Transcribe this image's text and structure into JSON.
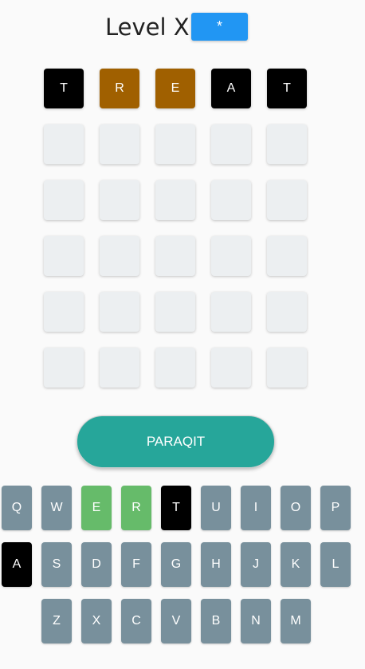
{
  "header": {
    "title": "Level X",
    "hint_button_label": "*"
  },
  "board": {
    "rows": [
      [
        {
          "letter": "T",
          "state": "absent"
        },
        {
          "letter": "R",
          "state": "present"
        },
        {
          "letter": "E",
          "state": "present"
        },
        {
          "letter": "A",
          "state": "absent"
        },
        {
          "letter": "T",
          "state": "absent"
        }
      ],
      [
        {
          "letter": "",
          "state": "empty"
        },
        {
          "letter": "",
          "state": "empty"
        },
        {
          "letter": "",
          "state": "empty"
        },
        {
          "letter": "",
          "state": "empty"
        },
        {
          "letter": "",
          "state": "empty"
        }
      ],
      [
        {
          "letter": "",
          "state": "empty"
        },
        {
          "letter": "",
          "state": "empty"
        },
        {
          "letter": "",
          "state": "empty"
        },
        {
          "letter": "",
          "state": "empty"
        },
        {
          "letter": "",
          "state": "empty"
        }
      ],
      [
        {
          "letter": "",
          "state": "empty"
        },
        {
          "letter": "",
          "state": "empty"
        },
        {
          "letter": "",
          "state": "empty"
        },
        {
          "letter": "",
          "state": "empty"
        },
        {
          "letter": "",
          "state": "empty"
        }
      ],
      [
        {
          "letter": "",
          "state": "empty"
        },
        {
          "letter": "",
          "state": "empty"
        },
        {
          "letter": "",
          "state": "empty"
        },
        {
          "letter": "",
          "state": "empty"
        },
        {
          "letter": "",
          "state": "empty"
        }
      ],
      [
        {
          "letter": "",
          "state": "empty"
        },
        {
          "letter": "",
          "state": "empty"
        },
        {
          "letter": "",
          "state": "empty"
        },
        {
          "letter": "",
          "state": "empty"
        },
        {
          "letter": "",
          "state": "empty"
        }
      ]
    ]
  },
  "submit_label": "PARAQIT",
  "keyboard": {
    "rows": [
      [
        {
          "key": "Q",
          "state": "unused"
        },
        {
          "key": "W",
          "state": "unused"
        },
        {
          "key": "E",
          "state": "correct"
        },
        {
          "key": "R",
          "state": "correct"
        },
        {
          "key": "T",
          "state": "absent"
        },
        {
          "key": "U",
          "state": "unused"
        },
        {
          "key": "I",
          "state": "unused"
        },
        {
          "key": "O",
          "state": "unused"
        },
        {
          "key": "P",
          "state": "unused"
        }
      ],
      [
        {
          "key": "A",
          "state": "absent"
        },
        {
          "key": "S",
          "state": "unused"
        },
        {
          "key": "D",
          "state": "unused"
        },
        {
          "key": "F",
          "state": "unused"
        },
        {
          "key": "G",
          "state": "unused"
        },
        {
          "key": "H",
          "state": "unused"
        },
        {
          "key": "J",
          "state": "unused"
        },
        {
          "key": "K",
          "state": "unused"
        },
        {
          "key": "L",
          "state": "unused"
        }
      ],
      [
        {
          "key": "Z",
          "state": "unused"
        },
        {
          "key": "X",
          "state": "unused"
        },
        {
          "key": "C",
          "state": "unused"
        },
        {
          "key": "V",
          "state": "unused"
        },
        {
          "key": "B",
          "state": "unused"
        },
        {
          "key": "N",
          "state": "unused"
        },
        {
          "key": "M",
          "state": "unused"
        }
      ]
    ]
  },
  "colors": {
    "absent": "#000000",
    "present": "#a06000",
    "correct": "#66bb6a",
    "empty_cell": "#eceff1",
    "key_default": "#78909c",
    "submit": "#26a69a",
    "hint_button": "#2196f3"
  }
}
